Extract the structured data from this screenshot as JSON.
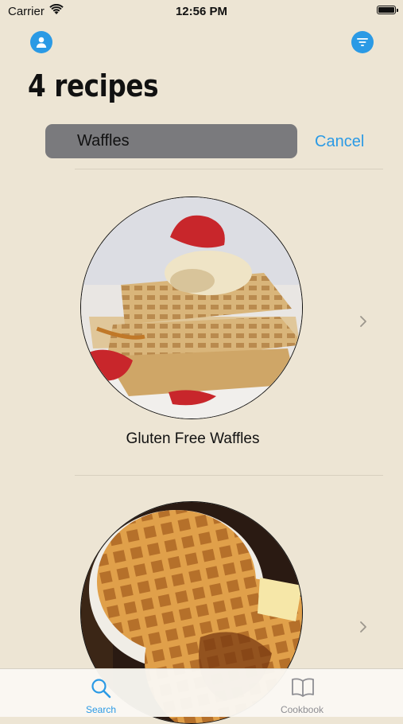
{
  "status": {
    "carrier": "Carrier",
    "time": "12:56 PM"
  },
  "header": {
    "title": "4 recipes",
    "profile_icon": "person-icon",
    "filter_icon": "filter-icon"
  },
  "search": {
    "value": "Waffles",
    "cancel_label": "Cancel"
  },
  "recipes": [
    {
      "name": "Gluten Free Waffles"
    },
    {
      "name": ""
    }
  ],
  "tabs": [
    {
      "label": "Search",
      "icon": "search-icon",
      "active": true
    },
    {
      "label": "Cookbook",
      "icon": "book-icon",
      "active": false
    }
  ],
  "colors": {
    "accent": "#2b9ae5",
    "background": "#ede5d4",
    "search_field": "#7a7a7d",
    "inactive_tab": "#8e8e93"
  }
}
